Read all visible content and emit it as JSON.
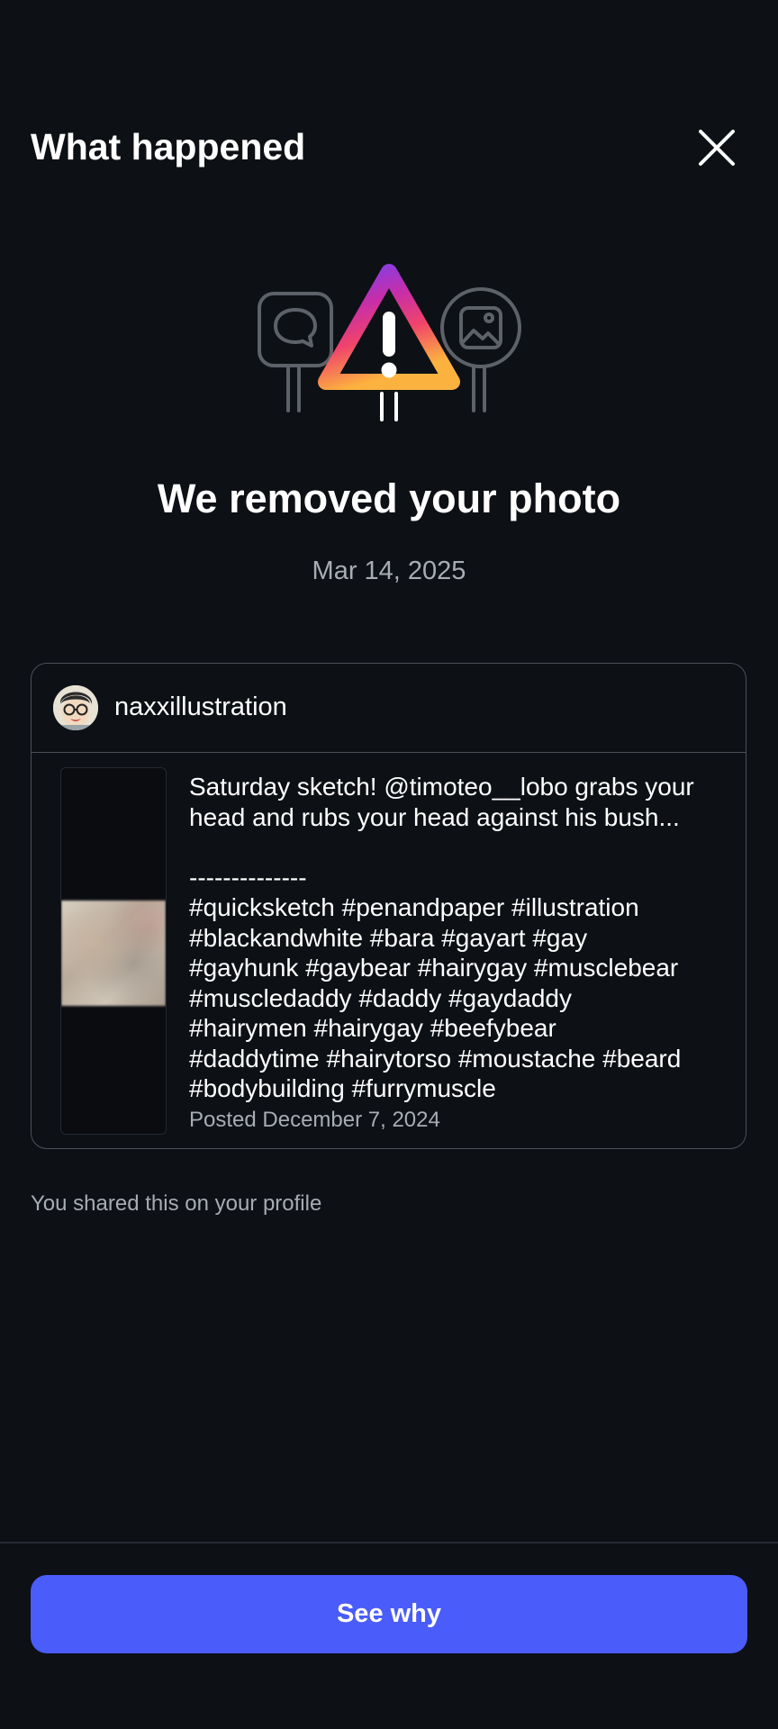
{
  "header": {
    "title": "What happened",
    "close_icon": "close-icon"
  },
  "hero": {
    "illustration": "warning-triangle-with-signs-illustration",
    "headline": "We removed your photo",
    "date": "Mar 14, 2025"
  },
  "post": {
    "username": "naxxillustration",
    "avatar_icon": "avatar-cartoon-glasses",
    "caption_lines": [
      "Saturday sketch! @timoteo__lobo grabs your",
      "head and rubs your head against his bush...",
      "",
      "--------------",
      "#quicksketch #penandpaper #illustration",
      "#blackandwhite #bara #gayart #gay",
      "#gayhunk #gaybear #hairygay #musclebear",
      "#muscledaddy #daddy #gaydaddy",
      "#hairymen #hairygay #beefybear",
      "#daddytime #hairytorso #moustache #beard",
      "#bodybuilding #furrymuscle"
    ],
    "posted": "Posted December 7, 2024"
  },
  "note": "You shared this on your profile",
  "footer": {
    "button_label": "See why"
  },
  "colors": {
    "background": "#0d1015",
    "accent": "#4a5cf9",
    "muted_text": "#a8acb3",
    "border": "#4c5058"
  }
}
